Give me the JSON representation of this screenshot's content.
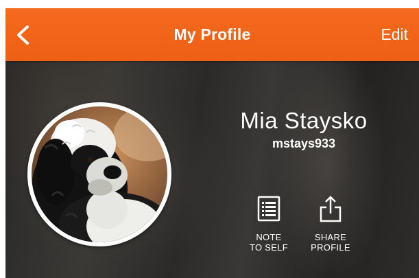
{
  "header": {
    "title": "My Profile",
    "edit_label": "Edit",
    "back_icon": "chevron-left-icon",
    "background_color": "#f0621a"
  },
  "profile": {
    "name": "Mia Staysko",
    "username": "mstays933",
    "avatar_subject": "black-and-white dog photo"
  },
  "actions": [
    {
      "label_line1": "NOTE",
      "label_line2": "TO SELF",
      "icon": "note-list-icon"
    },
    {
      "label_line1": "SHARE",
      "label_line2": "PROFILE",
      "icon": "share-upload-icon"
    }
  ]
}
